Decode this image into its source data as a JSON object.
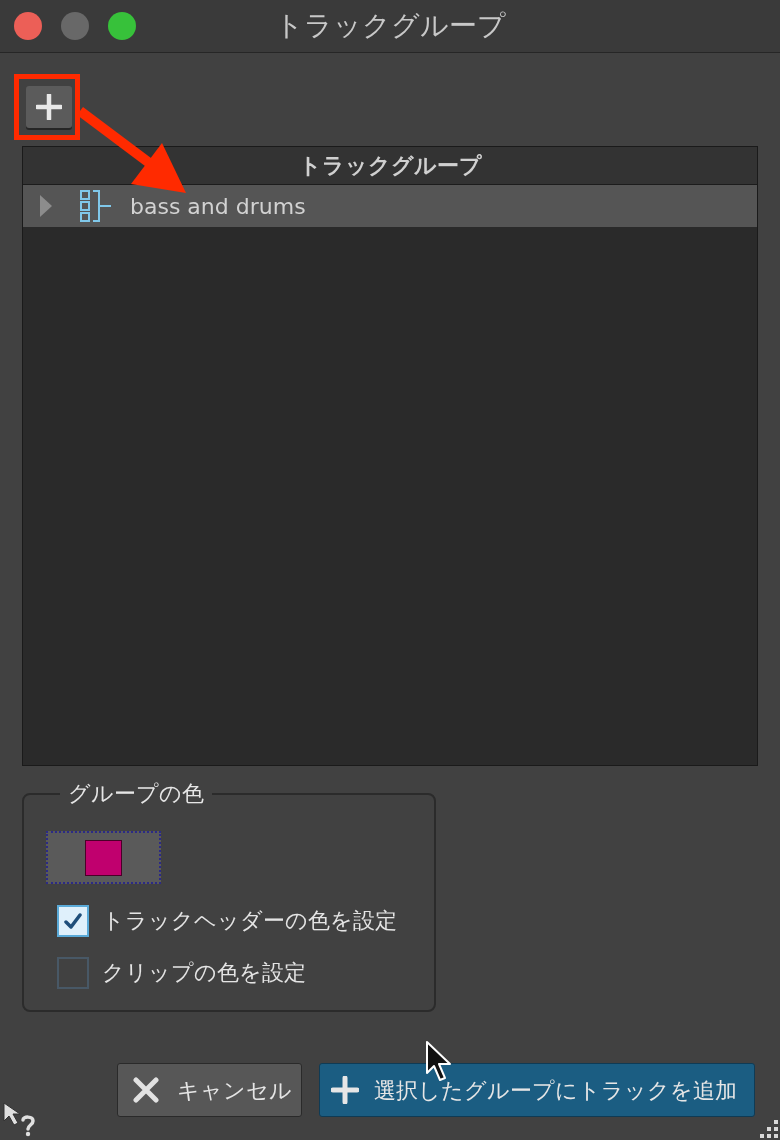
{
  "window": {
    "title": "トラックグループ",
    "controls": [
      {
        "kind": "close"
      },
      {
        "kind": "minimize"
      },
      {
        "kind": "zoom"
      }
    ]
  },
  "tree": {
    "header": "トラックグループ",
    "items": [
      {
        "label": "bass and drums",
        "selected": true,
        "expanded": false
      }
    ]
  },
  "group_color": {
    "legend": "グループの色",
    "color": "#c0006e",
    "checkboxes": [
      {
        "label": "トラックヘッダーの色を設定",
        "checked": true
      },
      {
        "label": "クリップの色を設定",
        "checked": false
      }
    ]
  },
  "buttons": [
    {
      "kind": "cancel",
      "label": "キャンセル",
      "default": false
    },
    {
      "kind": "add",
      "label": "選択したグループにトラックを追加",
      "default": true
    }
  ]
}
